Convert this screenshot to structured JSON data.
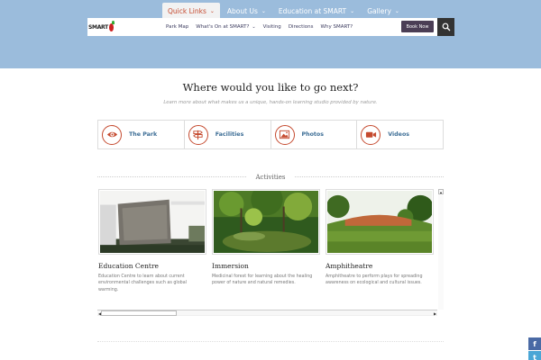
{
  "nav": {
    "items": [
      {
        "label": "Quick Links"
      },
      {
        "label": "About Us"
      },
      {
        "label": "Education at SMART"
      },
      {
        "label": "Gallery"
      }
    ],
    "sub_items": [
      {
        "label": "Park Map"
      },
      {
        "label": "What's On at SMART?"
      },
      {
        "label": "Visiting"
      },
      {
        "label": "Directions"
      },
      {
        "label": "Why SMART?"
      }
    ],
    "book_now": "Book Now",
    "logo_text": "SMART",
    "accent_color": "#c54a2f"
  },
  "intro": {
    "heading": "Where would you like to go next?",
    "tagline": "Learn more about what makes us a unique, hands-on learning studio provided by nature."
  },
  "cards": [
    {
      "label": "The Park",
      "icon": "eye-icon"
    },
    {
      "label": "Facilities",
      "icon": "signpost-icon"
    },
    {
      "label": "Photos",
      "icon": "image-icon"
    },
    {
      "label": "Videos",
      "icon": "video-camera-icon"
    }
  ],
  "activities": {
    "heading": "Activities",
    "items": [
      {
        "title": "Education Centre",
        "desc": "Education Centre to learn about current environmental challenges such as global warming."
      },
      {
        "title": "Immersion",
        "desc": "Medicinal forest for learning about the healing power of nature and natural remedies."
      },
      {
        "title": "Amphitheatre",
        "desc": "Amphitheatre to perform plays for spreading awareness on ecological and cultural issues."
      }
    ]
  },
  "social": {
    "facebook": "f",
    "twitter": "t"
  }
}
